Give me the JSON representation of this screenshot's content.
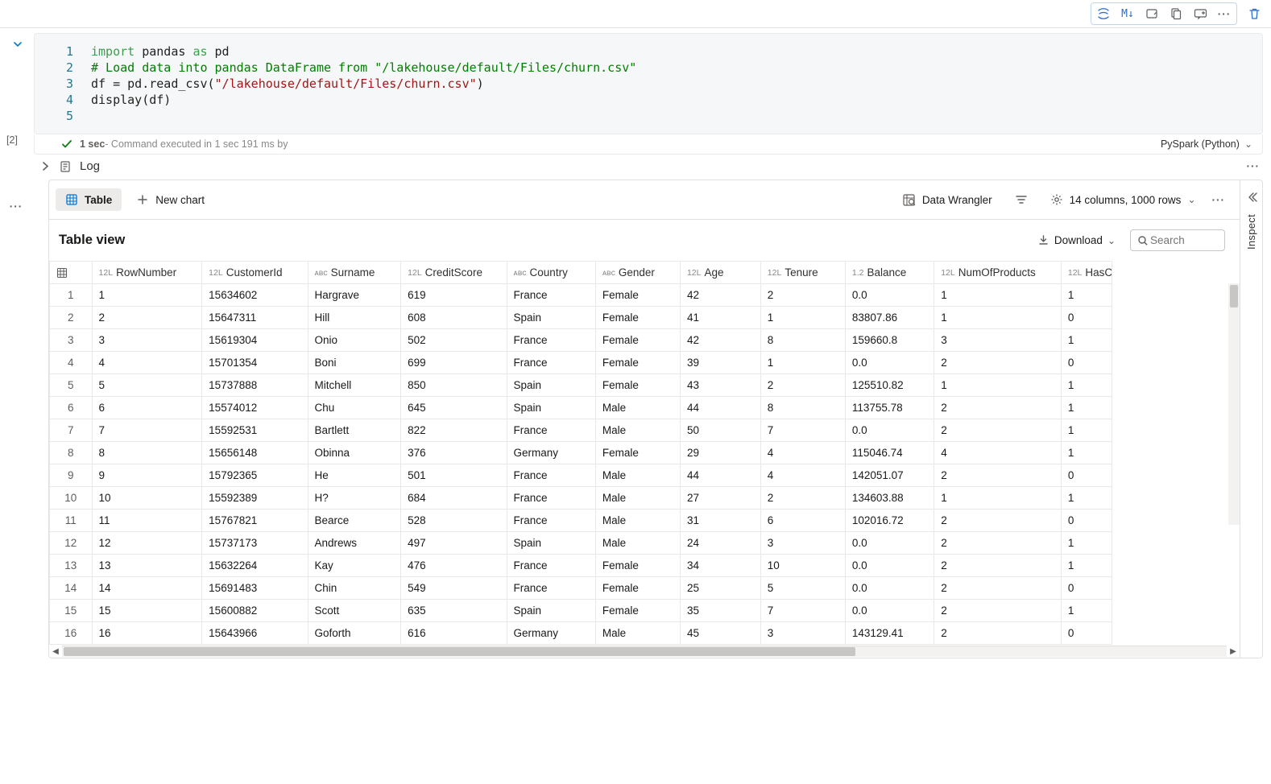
{
  "toolbar": {
    "kernel": "PySpark (Python)"
  },
  "cell": {
    "exec_num": "[2]",
    "lines": [
      "1",
      "2",
      "3",
      "4",
      "5"
    ],
    "code_tokens": [
      [
        {
          "t": "key",
          "v": "import"
        },
        {
          "t": "id",
          "v": " pandas "
        },
        {
          "t": "key",
          "v": "as"
        },
        {
          "t": "id",
          "v": " pd"
        }
      ],
      [
        {
          "t": "com",
          "v": "# Load data into pandas DataFrame from \"/lakehouse/default/Files/churn.csv\""
        }
      ],
      [
        {
          "t": "id",
          "v": "df = pd.read_csv("
        },
        {
          "t": "str",
          "v": "\"/lakehouse/default/Files/churn.csv\""
        },
        {
          "t": "id",
          "v": ")"
        }
      ],
      [
        {
          "t": "id",
          "v": "display(df)"
        }
      ],
      [
        {
          "t": "id",
          "v": ""
        }
      ]
    ],
    "status_time": "1 sec",
    "status_msg": " - Command executed in 1 sec 191 ms by"
  },
  "log": {
    "label": "Log"
  },
  "tabs": {
    "table": "Table",
    "newchart": "New chart",
    "wrangler": "Data Wrangler",
    "summary": "14 columns, 1000 rows"
  },
  "tableview": {
    "title": "Table view",
    "download": "Download",
    "search_ph": "Search"
  },
  "inspect": {
    "label": "Inspect"
  },
  "columns": [
    {
      "type": "12L",
      "name": "RowNumber",
      "w": "w-rn"
    },
    {
      "type": "12L",
      "name": "CustomerId",
      "w": "w-ci"
    },
    {
      "type": "ᴀʙᴄ",
      "name": "Surname",
      "w": "w-sn"
    },
    {
      "type": "12L",
      "name": "CreditScore",
      "w": "w-cs"
    },
    {
      "type": "ᴀʙᴄ",
      "name": "Country",
      "w": "w-co"
    },
    {
      "type": "ᴀʙᴄ",
      "name": "Gender",
      "w": "w-ge"
    },
    {
      "type": "12L",
      "name": "Age",
      "w": "w-ag"
    },
    {
      "type": "12L",
      "name": "Tenure",
      "w": "w-te"
    },
    {
      "type": "1.2",
      "name": "Balance",
      "w": "w-ba"
    },
    {
      "type": "12L",
      "name": "NumOfProducts",
      "w": "w-np"
    },
    {
      "type": "12L",
      "name": "HasC",
      "w": "w-hc"
    }
  ],
  "rows": [
    [
      "1",
      "1",
      "15634602",
      "Hargrave",
      "619",
      "France",
      "Female",
      "42",
      "2",
      "0.0",
      "1",
      "1"
    ],
    [
      "2",
      "2",
      "15647311",
      "Hill",
      "608",
      "Spain",
      "Female",
      "41",
      "1",
      "83807.86",
      "1",
      "0"
    ],
    [
      "3",
      "3",
      "15619304",
      "Onio",
      "502",
      "France",
      "Female",
      "42",
      "8",
      "159660.8",
      "3",
      "1"
    ],
    [
      "4",
      "4",
      "15701354",
      "Boni",
      "699",
      "France",
      "Female",
      "39",
      "1",
      "0.0",
      "2",
      "0"
    ],
    [
      "5",
      "5",
      "15737888",
      "Mitchell",
      "850",
      "Spain",
      "Female",
      "43",
      "2",
      "125510.82",
      "1",
      "1"
    ],
    [
      "6",
      "6",
      "15574012",
      "Chu",
      "645",
      "Spain",
      "Male",
      "44",
      "8",
      "113755.78",
      "2",
      "1"
    ],
    [
      "7",
      "7",
      "15592531",
      "Bartlett",
      "822",
      "France",
      "Male",
      "50",
      "7",
      "0.0",
      "2",
      "1"
    ],
    [
      "8",
      "8",
      "15656148",
      "Obinna",
      "376",
      "Germany",
      "Female",
      "29",
      "4",
      "115046.74",
      "4",
      "1"
    ],
    [
      "9",
      "9",
      "15792365",
      "He",
      "501",
      "France",
      "Male",
      "44",
      "4",
      "142051.07",
      "2",
      "0"
    ],
    [
      "10",
      "10",
      "15592389",
      "H?",
      "684",
      "France",
      "Male",
      "27",
      "2",
      "134603.88",
      "1",
      "1"
    ],
    [
      "11",
      "11",
      "15767821",
      "Bearce",
      "528",
      "France",
      "Male",
      "31",
      "6",
      "102016.72",
      "2",
      "0"
    ],
    [
      "12",
      "12",
      "15737173",
      "Andrews",
      "497",
      "Spain",
      "Male",
      "24",
      "3",
      "0.0",
      "2",
      "1"
    ],
    [
      "13",
      "13",
      "15632264",
      "Kay",
      "476",
      "France",
      "Female",
      "34",
      "10",
      "0.0",
      "2",
      "1"
    ],
    [
      "14",
      "14",
      "15691483",
      "Chin",
      "549",
      "France",
      "Female",
      "25",
      "5",
      "0.0",
      "2",
      "0"
    ],
    [
      "15",
      "15",
      "15600882",
      "Scott",
      "635",
      "Spain",
      "Female",
      "35",
      "7",
      "0.0",
      "2",
      "1"
    ],
    [
      "16",
      "16",
      "15643966",
      "Goforth",
      "616",
      "Germany",
      "Male",
      "45",
      "3",
      "143129.41",
      "2",
      "0"
    ]
  ]
}
